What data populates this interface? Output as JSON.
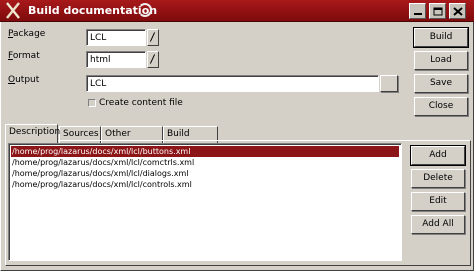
{
  "window": {
    "title": "Build documentation"
  },
  "form": {
    "package_label": "Package",
    "package_value": "LCL",
    "format_label": "Format",
    "format_value": "html",
    "output_label": "Output",
    "output_value": "LCL",
    "create_content_file_label": "Create content file",
    "create_content_file_checked": false
  },
  "buttons": {
    "build": "Build",
    "load": "Load",
    "save": "Save",
    "close": "Close"
  },
  "tabs": [
    {
      "label": "Description",
      "active": true
    },
    {
      "label": "Sources",
      "active": false
    },
    {
      "label": "Other options",
      "active": false
    },
    {
      "label": "Build output",
      "active": false
    }
  ],
  "files": [
    "/home/prog/lazarus/docs/xml/lcl/buttons.xml",
    "/home/prog/lazarus/docs/xml/lcl/comctrls.xml",
    "/home/prog/lazarus/docs/xml/lcl/dialogs.xml",
    "/home/prog/lazarus/docs/xml/lcl/controls.xml"
  ],
  "file_buttons": {
    "add": "Add",
    "delete": "Delete",
    "edit": "Edit",
    "add_all": "Add All"
  },
  "colors": {
    "titlebar": "#9b1416",
    "selection": "#8b1517",
    "window_bg": "#d4d0c8"
  },
  "icons": {
    "logo": "x-logo-icon",
    "minimize": "minimize-icon",
    "maximize": "maximize-icon",
    "close": "close-icon"
  }
}
